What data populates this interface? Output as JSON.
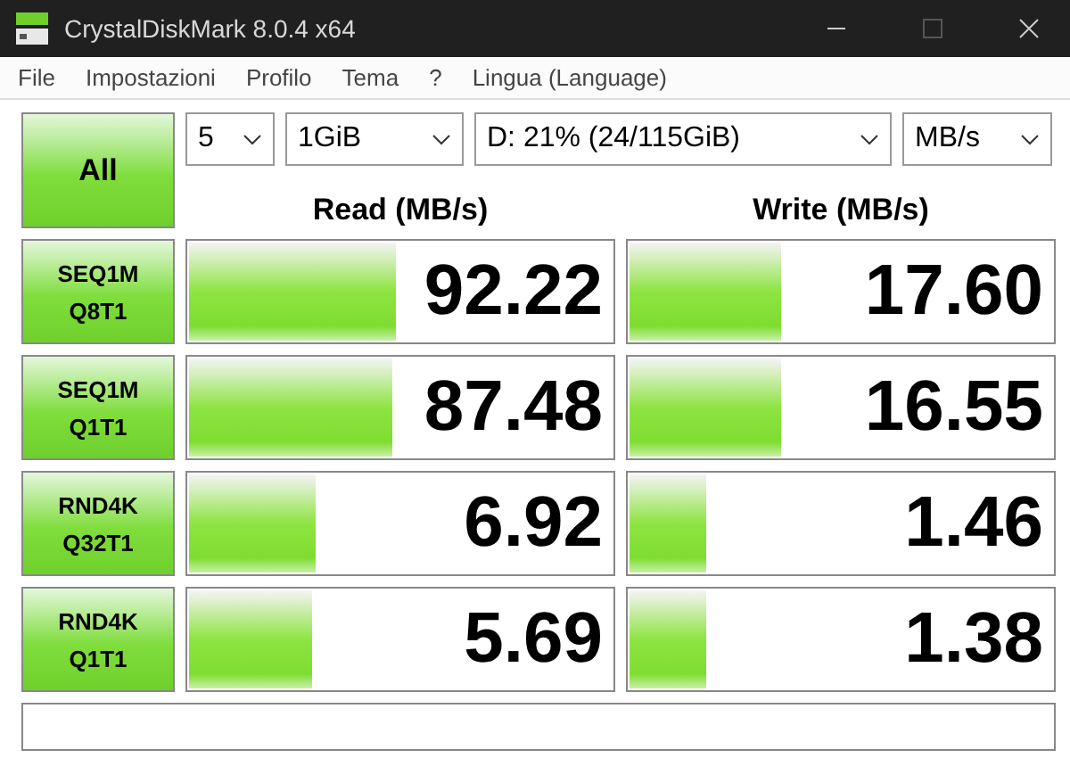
{
  "window": {
    "title": "CrystalDiskMark 8.0.4 x64"
  },
  "menu": [
    "File",
    "Impostazioni",
    "Profilo",
    "Tema",
    "?",
    "Lingua (Language)"
  ],
  "all_button": "All",
  "selectors": [
    {
      "value": "5"
    },
    {
      "value": "1GiB"
    },
    {
      "value": "D: 21% (24/115GiB)"
    },
    {
      "value": "MB/s"
    }
  ],
  "headers": [
    "Read (MB/s)",
    "Write (MB/s)"
  ],
  "tests": [
    {
      "name": "SEQ1M",
      "params": "Q8T1",
      "read": {
        "value": "92.22",
        "level": 0.49
      },
      "write": {
        "value": "17.60",
        "level": 0.36
      }
    },
    {
      "name": "SEQ1M",
      "params": "Q1T1",
      "read": {
        "value": "87.48",
        "level": 0.48
      },
      "write": {
        "value": "16.55",
        "level": 0.36
      }
    },
    {
      "name": "RND4K",
      "params": "Q32T1",
      "read": {
        "value": "6.92",
        "level": 0.3
      },
      "write": {
        "value": "1.46",
        "level": 0.18
      }
    },
    {
      "name": "RND4K",
      "params": "Q1T1",
      "read": {
        "value": "5.69",
        "level": 0.29
      },
      "write": {
        "value": "1.38",
        "level": 0.18
      }
    }
  ]
}
